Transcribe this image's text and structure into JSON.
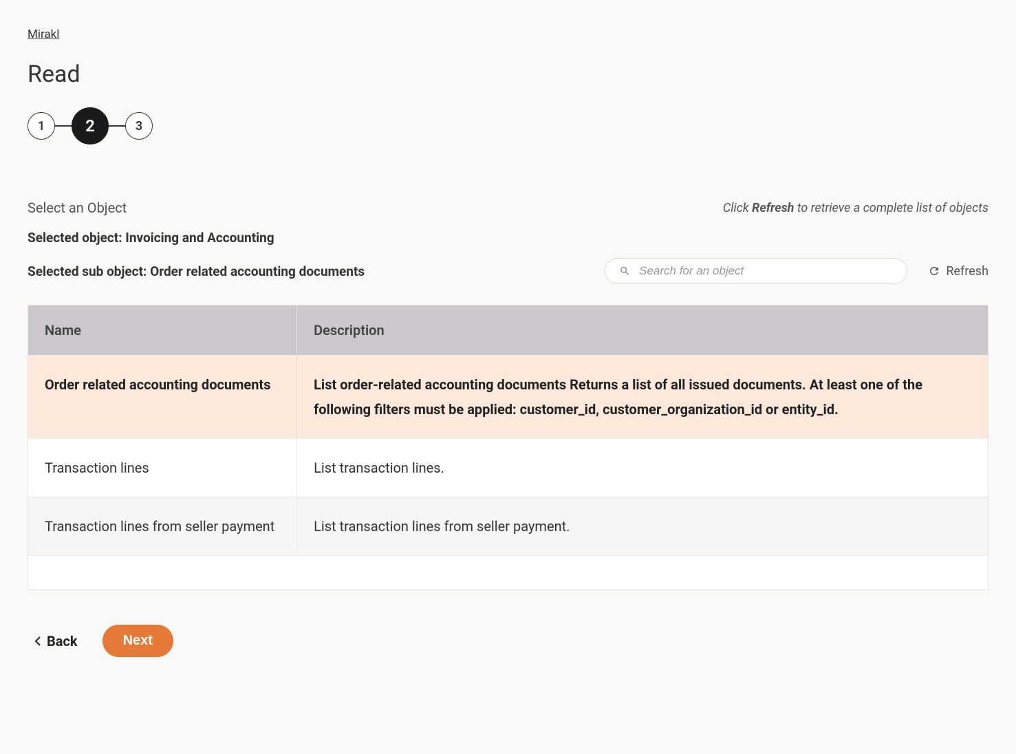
{
  "breadcrumb": {
    "label": "Mirakl"
  },
  "page_title": "Read",
  "stepper": {
    "steps": [
      "1",
      "2",
      "3"
    ],
    "active_index": 1
  },
  "section": {
    "select_label": "Select an Object",
    "refresh_hint_prefix": "Click ",
    "refresh_hint_bold": "Refresh",
    "refresh_hint_suffix": " to retrieve a complete list of objects",
    "selected_object_prefix": "Selected object: ",
    "selected_object_value": "Invoicing and Accounting",
    "selected_sub_object_prefix": "Selected sub object: ",
    "selected_sub_object_value": "Order related accounting documents"
  },
  "search": {
    "placeholder": "Search for an object",
    "value": ""
  },
  "refresh_label": "Refresh",
  "table": {
    "headers": {
      "name": "Name",
      "description": "Description"
    },
    "rows": [
      {
        "name": "Order related accounting documents",
        "description": "List order-related accounting documents Returns a list of all issued documents. At least one of the following filters must be applied: customer_id, customer_organization_id or entity_id.",
        "selected": true
      },
      {
        "name": "Transaction lines",
        "description": "List transaction lines.",
        "selected": false
      },
      {
        "name": "Transaction lines from seller payment",
        "description": "List transaction lines from seller payment.",
        "selected": false
      }
    ]
  },
  "buttons": {
    "back": "Back",
    "next": "Next"
  }
}
